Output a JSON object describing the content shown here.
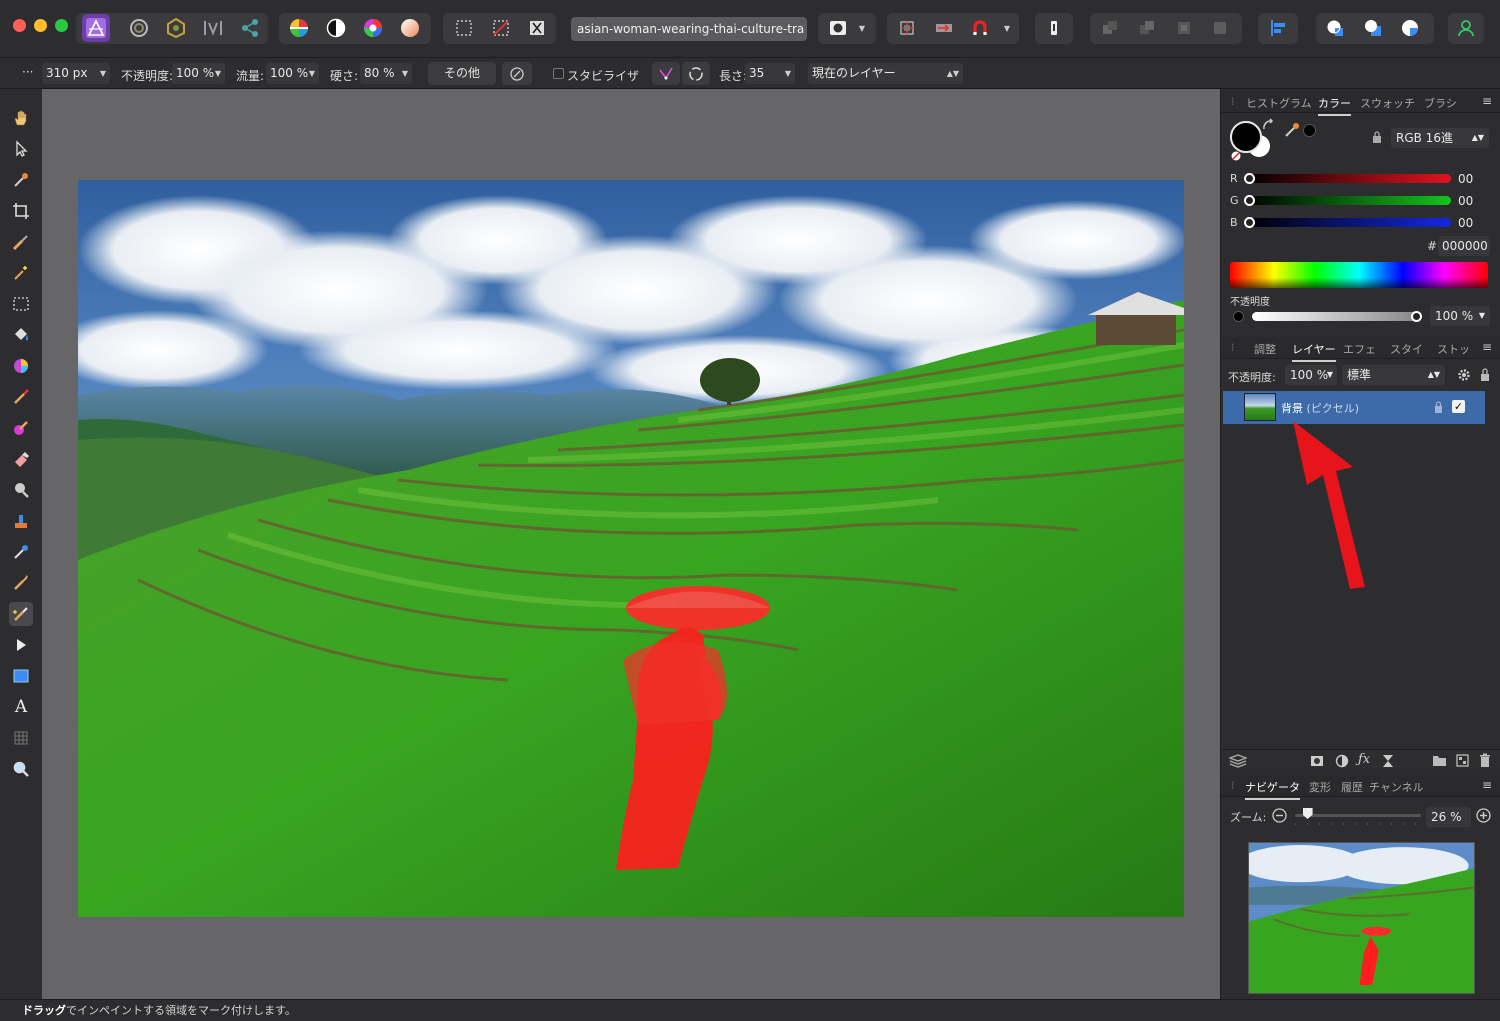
{
  "window": {
    "document_tab": "asian-woman-wearing-thai-culture-tra",
    "modified_mark": "✱"
  },
  "context_toolbar": {
    "more": "···",
    "width_value": "310 px",
    "opacity_label": "不透明度:",
    "opacity_value": "100 %",
    "flow_label": "流量:",
    "flow_value": "100 %",
    "hardness_label": "硬さ:",
    "hardness_value": "80 %",
    "more_button": "その他",
    "stabilizer_label": "スタビライザ",
    "length_label": "長さ:",
    "length_value": "35",
    "source_value": "現在のレイヤー"
  },
  "color_panel": {
    "tabs": [
      "ヒストグラム",
      "カラー",
      "スウォッチ",
      "ブラシ"
    ],
    "active_tab": "カラー",
    "mode": "RGB 16進",
    "channels": [
      {
        "name": "R",
        "value": "00",
        "color": "#e0141e"
      },
      {
        "name": "G",
        "value": "00",
        "color": "#14c41e"
      },
      {
        "name": "B",
        "value": "00",
        "color": "#1428e0"
      }
    ],
    "hex_label": "#:",
    "hex_value": "000000",
    "opacity_label": "不透明度",
    "opacity_value": "100 %",
    "opacity_fraction": 1.0
  },
  "layers_panel": {
    "tabs": [
      "調整",
      "レイヤー",
      "エフェ",
      "スタイ",
      "ストッ"
    ],
    "active_tab": "レイヤー",
    "opacity_label": "不透明度:",
    "opacity_value": "100 %",
    "blend_mode": "標準",
    "layers": [
      {
        "name": "背景",
        "kind": "(ピクセル)",
        "visible": true
      }
    ]
  },
  "navigator_panel": {
    "tabs": [
      "ナビゲータ",
      "変形",
      "履歴",
      "チャンネル"
    ],
    "active_tab": "ナビゲータ",
    "zoom_label": "ズーム:",
    "zoom_value": "26 %",
    "zoom_fraction": 0.1
  },
  "status_bar": {
    "bold": "ドラッグ",
    "text": "でインペイントする領域をマーク付けします。"
  },
  "colors": {
    "accent": "#2a7bff",
    "layer_selected": "#3d6aa8",
    "mask_red": "#ff1e1e",
    "arrow_red": "#e8141c"
  }
}
